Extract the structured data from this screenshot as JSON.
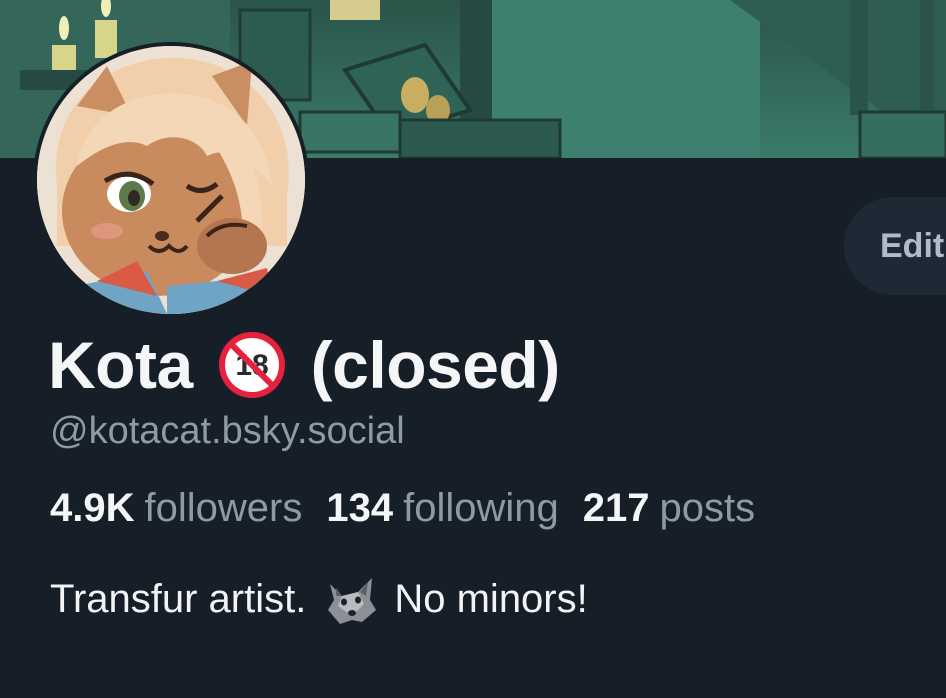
{
  "profile": {
    "display_name": "Kota",
    "name_emoji": "no-under-18-icon",
    "name_suffix": "(closed)",
    "handle": "@kotacat.bsky.social",
    "edit_label": "Edit"
  },
  "stats": [
    {
      "value": "4.9K",
      "label": "followers"
    },
    {
      "value": "134",
      "label": "following"
    },
    {
      "value": "217",
      "label": "posts"
    }
  ],
  "bio": {
    "before": "Transfur artist.",
    "emoji": "wolf-icon",
    "after": "No minors!"
  },
  "colors": {
    "background": "#161e27",
    "text_primary": "#f4f6f8",
    "text_secondary": "#8d9aa8",
    "button_bg": "#1f2936",
    "button_text": "#aebbc9"
  }
}
